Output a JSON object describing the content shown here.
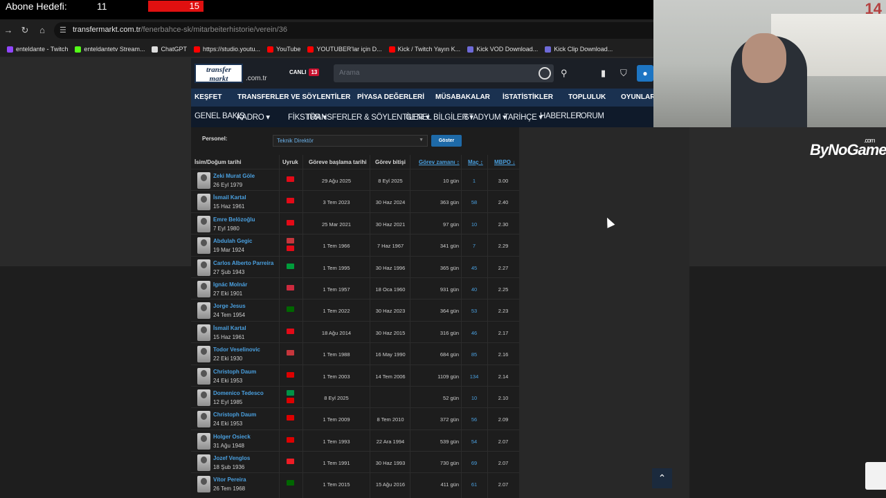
{
  "overlay": {
    "abone_label": "Abone Hedefi:",
    "abone_current": "11",
    "abone_goal": "15"
  },
  "browser": {
    "url_host": "transfermarkt.com.tr",
    "url_path": "/fenerbahce-sk/mitarbeiterhistorie/verein/36",
    "bookmarks": [
      {
        "label": "enteldante - Twitch",
        "color": "#9146ff"
      },
      {
        "label": "enteldantetv Stream...",
        "color": "#53fc18"
      },
      {
        "label": "ChatGPT",
        "color": "#dddddd"
      },
      {
        "label": "https://studio.youtu...",
        "color": "#ff0000"
      },
      {
        "label": "YouTube",
        "color": "#ff0000"
      },
      {
        "label": "YOUTUBER'lar için D...",
        "color": "#ff0000"
      },
      {
        "label": "Kick / Twitch Yayın K...",
        "color": "#ff0000"
      },
      {
        "label": "Kick VOD Download...",
        "color": "#6e6ad8"
      },
      {
        "label": "Kick Clip Download...",
        "color": "#6e6ad8"
      }
    ]
  },
  "site": {
    "logo_line1": "transfer",
    "logo_line2": "markt",
    "logo_tld": ".com.tr",
    "live_label": "CANLI",
    "live_count": "13",
    "search_placeholder": "Arama",
    "main_nav": [
      "KEŞFET",
      "TRANSFERLER VE SÖYLENTİLER",
      "PİYASA DEĞERLERİ",
      "MÜSABAKALAR",
      "İSTATİSTİKLER",
      "TOPLULUK",
      "OYUNLAR"
    ],
    "sub_nav": [
      "GENEL BAKIŞ",
      "KADRO ▾",
      "FİKSTÜR ▾",
      "TRANSFERLER & SÖYLENTİLER ▾",
      "GENEL BİLGİLER ▾",
      "STADYUM ▾",
      "TARİHÇE ▾",
      "HABERLER",
      "FORUM"
    ]
  },
  "filter": {
    "label": "Personel:",
    "value": "Teknik Direktör",
    "button": "Göster"
  },
  "table": {
    "headers": [
      "İsim/Doğum tarihi",
      "Uyruk",
      "Göreve başlama tarihi",
      "Görev bitişi",
      "Görev zamanı ↕",
      "Maç ↕",
      "MBPO ↓"
    ],
    "rows": [
      {
        "name": "Zeki Murat Göle",
        "dob": "26 Eyl 1979",
        "flags": [
          "#e30a17"
        ],
        "start": "29 Ağu 2025",
        "end": "8 Eyl 2025",
        "days": "10 gün",
        "matches": "1",
        "ppm": "3.00"
      },
      {
        "name": "İsmail Kartal",
        "dob": "15 Haz 1961",
        "flags": [
          "#e30a17"
        ],
        "start": "3 Tem 2023",
        "end": "30 Haz 2024",
        "days": "363 gün",
        "matches": "58",
        "ppm": "2.40"
      },
      {
        "name": "Emre Belözoğlu",
        "dob": "7 Eyl 1980",
        "flags": [
          "#e30a17"
        ],
        "start": "25 Mar 2021",
        "end": "30 Haz 2021",
        "days": "97 gün",
        "matches": "10",
        "ppm": "2.30"
      },
      {
        "name": "Abdulah Gegic",
        "dob": "19 Mar 1924",
        "flags": [
          "#c6363c",
          "#e30a17"
        ],
        "start": "1 Tem 1966",
        "end": "7 Haz 1967",
        "days": "341 gün",
        "matches": "7",
        "ppm": "2.29"
      },
      {
        "name": "Carlos Alberto Parreira",
        "dob": "27 Şub 1943",
        "flags": [
          "#009c3b"
        ],
        "start": "1 Tem 1995",
        "end": "30 Haz 1996",
        "days": "365 gün",
        "matches": "45",
        "ppm": "2.27"
      },
      {
        "name": "Ignác Molnár",
        "dob": "27 Eki 1901",
        "flags": [
          "#cd2a3e"
        ],
        "start": "1 Tem 1957",
        "end": "18 Oca 1960",
        "days": "931 gün",
        "matches": "40",
        "ppm": "2.25"
      },
      {
        "name": "Jorge Jesus",
        "dob": "24 Tem 1954",
        "flags": [
          "#006600"
        ],
        "start": "1 Tem 2022",
        "end": "30 Haz 2023",
        "days": "364 gün",
        "matches": "53",
        "ppm": "2.23"
      },
      {
        "name": "İsmail Kartal",
        "dob": "15 Haz 1961",
        "flags": [
          "#e30a17"
        ],
        "start": "18 Ağu 2014",
        "end": "30 Haz 2015",
        "days": "316 gün",
        "matches": "46",
        "ppm": "2.17"
      },
      {
        "name": "Todor Veselinovic",
        "dob": "22 Eki 1930",
        "flags": [
          "#c6363c"
        ],
        "start": "1 Tem 1988",
        "end": "16 May 1990",
        "days": "684 gün",
        "matches": "85",
        "ppm": "2.16"
      },
      {
        "name": "Christoph Daum",
        "dob": "24 Eki 1953",
        "flags": [
          "#dd0000"
        ],
        "start": "1 Tem 2003",
        "end": "14 Tem 2006",
        "days": "1109 gün",
        "matches": "134",
        "ppm": "2.14"
      },
      {
        "name": "Domenico Tedesco",
        "dob": "12 Eyl 1985",
        "flags": [
          "#009246",
          "#dd0000"
        ],
        "start": "8 Eyl 2025",
        "end": "",
        "days": "52 gün",
        "matches": "10",
        "ppm": "2.10"
      },
      {
        "name": "Christoph Daum",
        "dob": "24 Eki 1953",
        "flags": [
          "#dd0000"
        ],
        "start": "1 Tem 2009",
        "end": "8 Tem 2010",
        "days": "372 gün",
        "matches": "56",
        "ppm": "2.09"
      },
      {
        "name": "Holger Osieck",
        "dob": "31 Ağu 1948",
        "flags": [
          "#dd0000"
        ],
        "start": "1 Tem 1993",
        "end": "22 Ara 1994",
        "days": "539 gün",
        "matches": "54",
        "ppm": "2.07"
      },
      {
        "name": "Jozef Venglos",
        "dob": "18 Şub 1936",
        "flags": [
          "#ee1c25"
        ],
        "start": "1 Tem 1991",
        "end": "30 Haz 1993",
        "days": "730 gün",
        "matches": "69",
        "ppm": "2.07"
      },
      {
        "name": "Vítor Pereira",
        "dob": "26 Tem 1968",
        "flags": [
          "#006600"
        ],
        "start": "1 Tem 2015",
        "end": "15 Ağu 2016",
        "days": "411 gün",
        "matches": "61",
        "ppm": "2.07"
      }
    ]
  },
  "webcam": {
    "counter": "14"
  },
  "brand": {
    "name": "ByNoGame",
    "suffix": ".com"
  }
}
